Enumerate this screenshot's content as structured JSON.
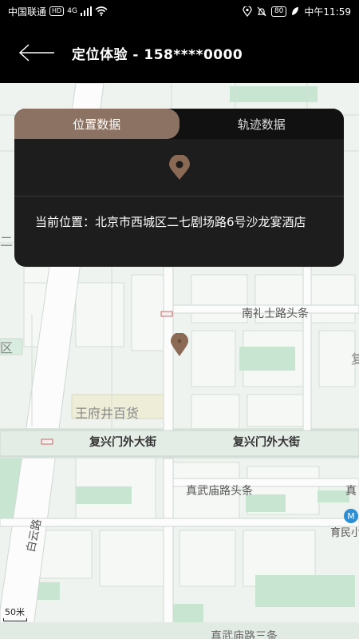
{
  "status_bar": {
    "carrier": "中国联通",
    "hd_badge": "HD",
    "network": "4G",
    "battery": "80",
    "time": "中午11:59"
  },
  "header": {
    "back_icon": "arrow-left-icon",
    "title": "定位体验  -  158****0000"
  },
  "card": {
    "tabs": [
      {
        "label": "位置数据",
        "active": true
      },
      {
        "label": "轨迹数据",
        "active": false
      }
    ],
    "pin_icon": "location-pin-icon",
    "location_text": "当前位置：北京市西城区二七剧场路6号沙龙宴酒店"
  },
  "map": {
    "labels": {
      "nanlishi": "南礼士路头条",
      "wangfujing": "王府井百货",
      "fuxingmen_1": "复兴门外大街",
      "fuxingmen_2": "复兴门外大街",
      "zhenwumiao": "真武庙路头条",
      "zhenwumiao_right": "真",
      "zhenwumiao_3": "真武庙路三条",
      "baiyun": "白云路",
      "yumin": "育民小",
      "qu_left": "区",
      "left_edge": "二",
      "right_edge": "复"
    },
    "scale": "50米",
    "marker_color": "#8a6a55"
  }
}
